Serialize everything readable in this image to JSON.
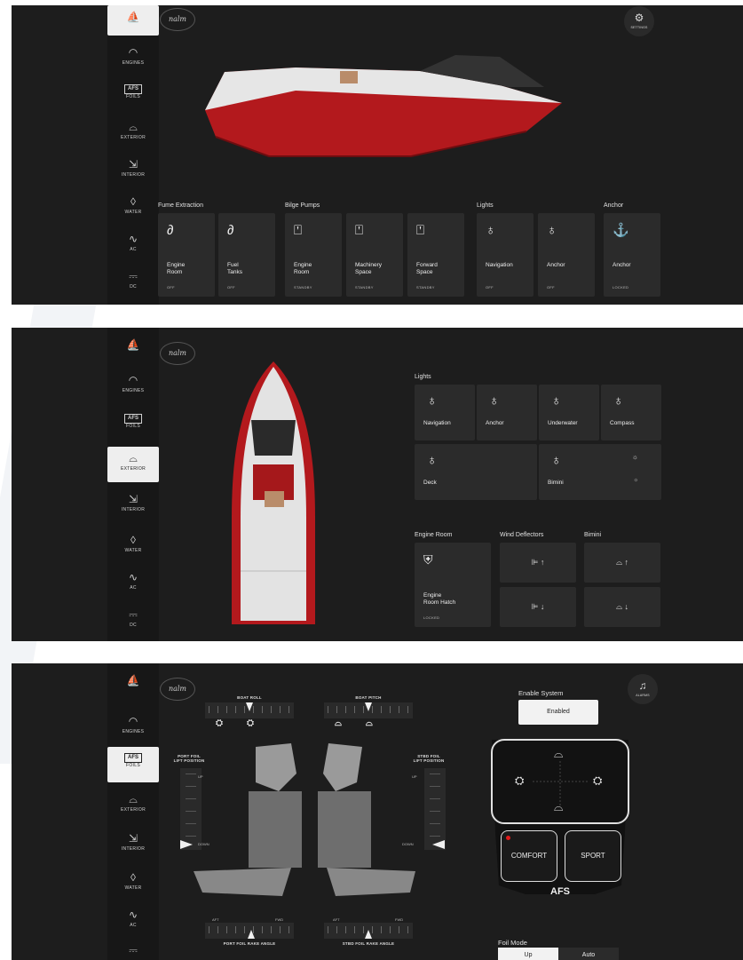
{
  "brand": "nalm",
  "nav": [
    {
      "label": "",
      "icon": "boat-home-icon",
      "glyph": "⛵"
    },
    {
      "label": "ENGINES",
      "icon": "gauge-icon",
      "glyph": "◠"
    },
    {
      "label": "FOILS",
      "icon": "afs-icon",
      "glyph": "AFS"
    },
    {
      "label": "EXTERIOR",
      "icon": "boat-exterior-icon",
      "glyph": "⌓"
    },
    {
      "label": "INTERIOR",
      "icon": "seat-icon",
      "glyph": "⇲"
    },
    {
      "label": "WATER",
      "icon": "water-drop-icon",
      "glyph": "◊"
    },
    {
      "label": "AC",
      "icon": "ac-wave-icon",
      "glyph": "∿"
    },
    {
      "label": "DC",
      "icon": "dc-icon",
      "glyph": "⎓"
    }
  ],
  "panel1": {
    "settings_label": "SETTINGS",
    "groups": [
      "Fume Extraction",
      "Bilge Pumps",
      "Lights",
      "Anchor"
    ],
    "tiles": [
      {
        "name": "Engine\nRoom",
        "status": "OFF",
        "glyph": "∂"
      },
      {
        "name": "Fuel\nTanks",
        "status": "OFF",
        "glyph": "∂"
      },
      {
        "name": "Engine\nRoom",
        "status": "STANDBY",
        "glyph": "⍞"
      },
      {
        "name": "Machinery\nSpace",
        "status": "STANDBY",
        "glyph": "⍞"
      },
      {
        "name": "Forward\nSpace",
        "status": "STANDBY",
        "glyph": "⍞"
      },
      {
        "name": "Navigation",
        "status": "OFF",
        "glyph": "♁"
      },
      {
        "name": "Anchor",
        "status": "OFF",
        "glyph": "♁"
      },
      {
        "name": "Anchor",
        "status": "LOCKED",
        "glyph": "⚓"
      }
    ]
  },
  "panel2": {
    "lights_title": "Lights",
    "lights": [
      "Navigation",
      "Anchor",
      "Underwater",
      "Compass",
      "Deck",
      "Bimini"
    ],
    "engine_room_title": "Engine Room",
    "wind_title": "Wind Deflectors",
    "bimini_title": "Bimini",
    "hatch_name": "Engine\nRoom Hatch",
    "hatch_status": "LOCKED",
    "wind_up": "⊫ ↑",
    "wind_down": "⊫ ↓",
    "bimini_up": "⌓ ↑",
    "bimini_down": "⌓ ↓"
  },
  "panel3": {
    "alarms_label": "ALARMS",
    "boat_roll": "BOAT ROLL",
    "boat_pitch": "BOAT PITCH",
    "port_lift": "PORT FOIL\nLIFT POSITION",
    "stbd_lift": "STBD FOIL\nLIFT POSITION",
    "up": "UP",
    "down": "DOWN",
    "aft": "AFT",
    "fwd": "FWD",
    "port_rake": "PORT FOIL RAKE ANGLE",
    "stbd_rake": "STBD FOIL RAKE ANGLE",
    "enable_title": "Enable System",
    "enable_value": "Enabled",
    "comfort": "COMFORT",
    "sport": "SPORT",
    "afs": "AFS",
    "foil_mode_title": "Foil Mode",
    "foil_mode_options": [
      "Up",
      "Auto"
    ],
    "foil_mode_selected": "Up"
  },
  "colors": {
    "panel": "#1d1d1d",
    "tile": "#2b2b2b",
    "hull": "#b3191d",
    "indicator": "#e21b1b"
  }
}
